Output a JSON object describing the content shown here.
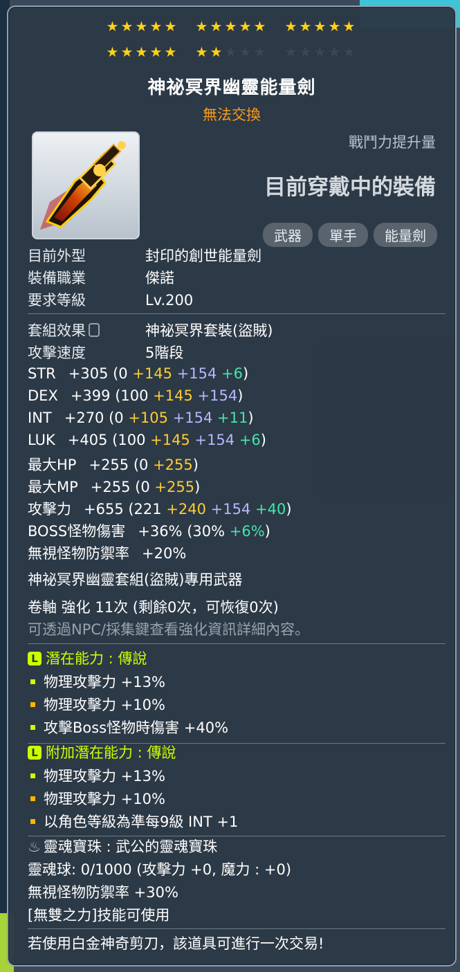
{
  "stars": {
    "rows": [
      [
        1,
        1,
        1,
        1,
        1,
        1,
        1,
        1,
        1,
        1,
        1,
        1,
        1,
        1,
        1
      ],
      [
        1,
        1,
        1,
        1,
        1,
        1,
        1,
        0,
        0,
        0,
        0,
        0,
        0,
        0,
        0
      ]
    ]
  },
  "item": {
    "name": "神祕冥界幽靈能量劍",
    "trade_status": "無法交換",
    "icon": "energy-sword-icon",
    "cp_label": "戰鬥力提升量",
    "equipped_label": "目前穿戴中的裝備",
    "tags": [
      "武器",
      "單手",
      "能量劍"
    ]
  },
  "basic": [
    {
      "label": "目前外型",
      "value": "封印的創世能量劍"
    },
    {
      "label": "裝備職業",
      "value": "傑諾"
    },
    {
      "label": "要求等級",
      "value": "Lv.200"
    }
  ],
  "set_effect": {
    "label": "套組效果",
    "value": "神祕冥界套裝(盜賊)"
  },
  "attack_speed": {
    "label": "攻擊速度",
    "value": "5階段"
  },
  "stats": [
    {
      "name": "STR",
      "total": "+305",
      "parts": [
        "(0",
        "+145",
        "+154",
        "+6",
        ")"
      ]
    },
    {
      "name": "DEX",
      "total": "+399",
      "parts": [
        "(100",
        "+145",
        "+154",
        "",
        ")"
      ]
    },
    {
      "name": "INT",
      "total": "+270",
      "parts": [
        "(0",
        "+105",
        "+154",
        "+11",
        ")"
      ]
    },
    {
      "name": "LUK",
      "total": "+405",
      "parts": [
        "(100",
        "+145",
        "+154",
        "+6",
        ")"
      ]
    },
    {
      "name": "最大HP",
      "total": "+255",
      "parts": [
        "(0",
        "+255",
        "",
        "",
        ")"
      ]
    },
    {
      "name": "最大MP",
      "total": "+255",
      "parts": [
        "(0",
        "+255",
        "",
        "",
        ")"
      ]
    },
    {
      "name": "攻擊力",
      "total": "+655",
      "parts": [
        "(221",
        "+240",
        "+154",
        "+40",
        ")"
      ]
    },
    {
      "name": "BOSS怪物傷害",
      "total": "+36%",
      "parts": [
        "(30%",
        "",
        "",
        "+6%",
        ")"
      ]
    },
    {
      "name": "無視怪物防禦率",
      "total": "+20%",
      "parts": [
        "",
        "",
        "",
        "",
        ""
      ]
    }
  ],
  "exclusive": "神祕冥界幽靈套組(盜賊)專用武器",
  "scroll": "卷軸 強化 11次 (剩餘0次，可恢復0次)",
  "scroll_hint": "可透過NPC/採集鍵查看強化資訊詳細內容。",
  "potential": {
    "title": "潛在能力 : 傳說",
    "lines": [
      "物理攻擊力 +13%",
      "物理攻擊力 +10%",
      "攻擊Boss怪物時傷害 +40%"
    ],
    "bullet_colors": [
      "lime",
      "gold",
      "lime"
    ]
  },
  "bonus_potential": {
    "title": "附加潛在能力 : 傳說",
    "lines": [
      "物理攻擊力 +13%",
      "物理攻擊力 +10%",
      "以角色等級為準每9級 INT +1"
    ],
    "bullet_colors": [
      "lime",
      "gold",
      "gold"
    ]
  },
  "soul": {
    "title": "靈魂寶珠 : 武公的靈魂寶珠",
    "orb": "靈魂球: 0/1000 (攻擊力 +0, 魔力 : +0)",
    "ignore_def": "無視怪物防禦率 +30%",
    "skill": "[無雙之力]技能可使用"
  },
  "footer": "若使用白金神奇剪刀，該道具可進行一次交易!"
}
